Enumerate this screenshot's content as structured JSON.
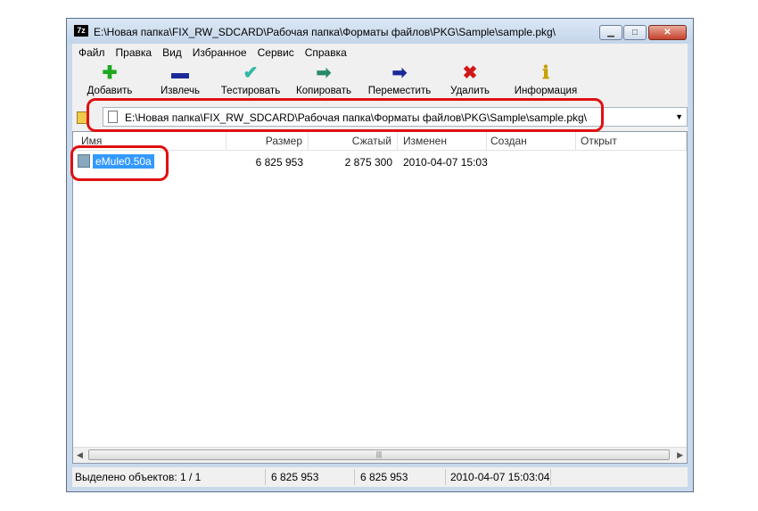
{
  "window": {
    "title": "E:\\Новая папка\\FIX_RW_SDCARD\\Рабочая папка\\Форматы файлов\\PKG\\Sample\\sample.pkg\\",
    "app_icon": "7z"
  },
  "menu": [
    "Файл",
    "Правка",
    "Вид",
    "Избранное",
    "Сервис",
    "Справка"
  ],
  "toolbar": [
    {
      "label": "Добавить",
      "icon": "add-icon",
      "color": "#1ea81e"
    },
    {
      "label": "Извлечь",
      "icon": "extract-icon",
      "color": "#1a2a9a"
    },
    {
      "label": "Тестировать",
      "icon": "test-icon",
      "color": "#30b8a8"
    },
    {
      "label": "Копировать",
      "icon": "copy-icon",
      "color": "#2a8a6a"
    },
    {
      "label": "Переместить",
      "icon": "move-icon",
      "color": "#1a2a9a"
    },
    {
      "label": "Удалить",
      "icon": "delete-icon",
      "color": "#d01818"
    },
    {
      "label": "Информация",
      "icon": "info-icon",
      "color": "#c8a000"
    }
  ],
  "address": {
    "path": "E:\\Новая папка\\FIX_RW_SDCARD\\Рабочая папка\\Форматы файлов\\PKG\\Sample\\sample.pkg\\"
  },
  "columns": [
    "Имя",
    "Размер",
    "Сжатый",
    "Изменен",
    "Создан",
    "Открыт"
  ],
  "files": [
    {
      "name": "eMule0.50a",
      "size": "6 825 953",
      "packed": "2 875 300",
      "modified": "2010-04-07 15:03",
      "created": "",
      "accessed": ""
    }
  ],
  "status": {
    "selected": "Выделено объектов: 1 / 1",
    "size": "6 825 953",
    "size2": "6 825 953",
    "date": "2010-04-07 15:03:04"
  },
  "colors": {
    "highlight": "#e01010",
    "selection": "#3399ff"
  }
}
